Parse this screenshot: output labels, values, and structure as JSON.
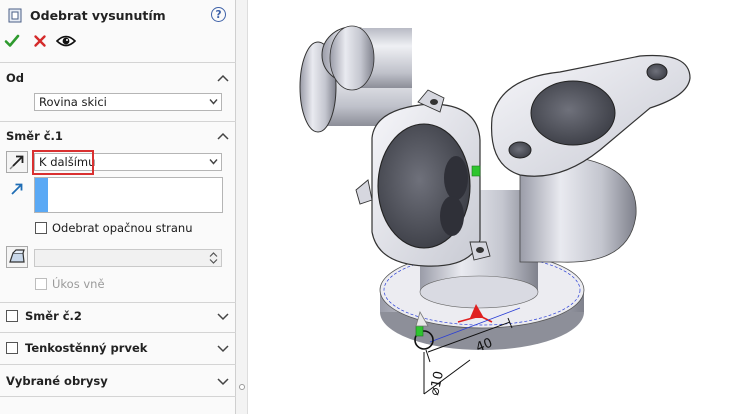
{
  "property_manager": {
    "title": "Odebrat vysunutím",
    "help_symbol": "?",
    "sections": {
      "from": {
        "title": "Od",
        "start_condition": "Rovina skici"
      },
      "direction1": {
        "title": "Směr č.1",
        "end_condition": "K dalšímu",
        "flip_side_to_cut_label": "Odebrat opačnou stranu",
        "draft_outward_label": "Úkos vně"
      },
      "direction2": {
        "title": "Směr č.2"
      },
      "thin_feature": {
        "title": "Tenkostěnný prvek"
      },
      "selected_contours": {
        "title": "Vybrané obrysy"
      }
    }
  },
  "viewport": {
    "dimension_labels": [
      "40",
      "⌀10"
    ],
    "colors": {
      "sketch_blue": "#2b3fd6",
      "sketch_red": "#e02020",
      "handle_green": "#2ec52e",
      "highlight_red": "#d93030"
    }
  }
}
